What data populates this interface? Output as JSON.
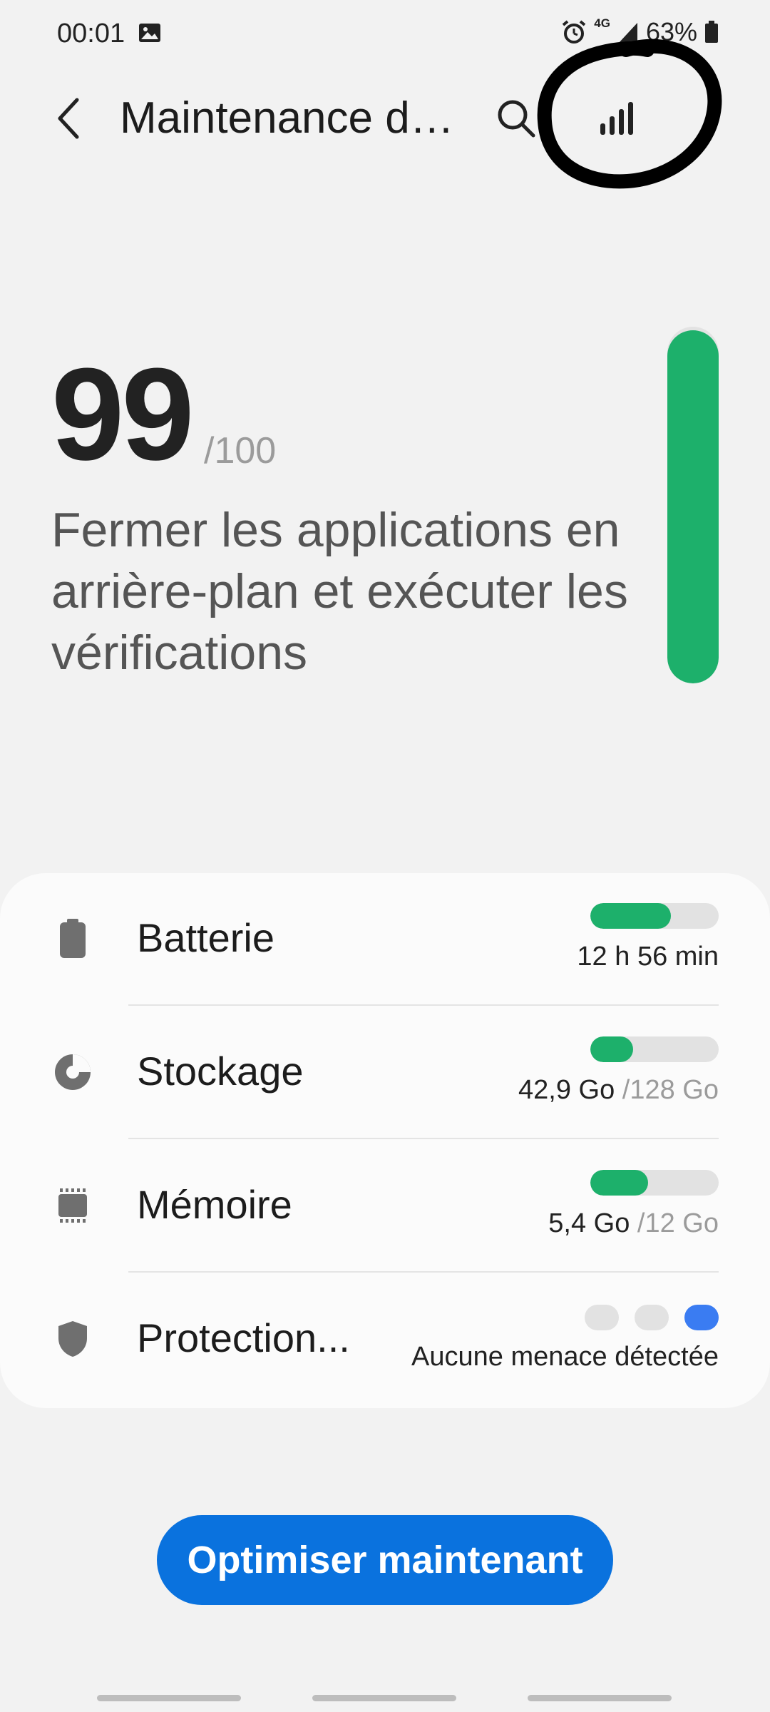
{
  "status_bar": {
    "time": "00:01",
    "network": "4G",
    "battery": "63%"
  },
  "header": {
    "title": "Maintenance de...",
    "back_icon": "chevron-left-icon",
    "search_icon": "search-icon",
    "stats_icon": "bar-chart-icon"
  },
  "score": {
    "value": "99",
    "max": "/100",
    "fraction": 0.99,
    "description": "Fermer les applications en arrière-plan et exécuter les vérifications",
    "color": "#1db06b"
  },
  "items": [
    {
      "label": "Batterie",
      "icon": "battery-icon",
      "value": "12 h 56 min",
      "total": "",
      "fill": 0.63
    },
    {
      "label": "Stockage",
      "icon": "storage-pie-icon",
      "value": "42,9 Go ",
      "total": "/128 Go",
      "fill": 0.335
    },
    {
      "label": "Mémoire",
      "icon": "memory-chip-icon",
      "value": "5,4 Go ",
      "total": "/12 Go",
      "fill": 0.45
    }
  ],
  "protection": {
    "label": "Protection...",
    "icon": "shield-icon",
    "value": "Aucune menace détectée",
    "level_dots": 3,
    "active_dot": 3,
    "active_color": "#3a7cf2"
  },
  "optimize_button": {
    "label": "Optimiser maintenant",
    "color": "#0a72de"
  }
}
